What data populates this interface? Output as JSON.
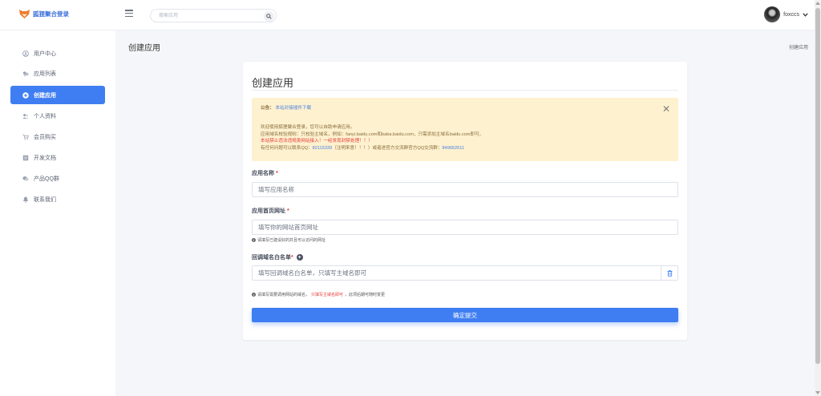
{
  "brand": {
    "name": "狐狸聚合登录",
    "icon": "fox-logo-icon"
  },
  "header": {
    "menu_icon": "hamburger-icon",
    "search_placeholder": "搜索应用",
    "search_icon": "search-icon",
    "username": "foxccs"
  },
  "sidebar": {
    "items": [
      {
        "label": "用户中心",
        "icon": "user-circle-icon",
        "active": false
      },
      {
        "label": "应用列表",
        "icon": "apps-icon",
        "active": false
      },
      {
        "label": "创建应用",
        "icon": "plus-circle-icon",
        "active": true
      },
      {
        "label": "个人资料",
        "icon": "profile-icon",
        "active": false
      },
      {
        "label": "会员购买",
        "icon": "cart-icon",
        "active": false
      },
      {
        "label": "开发文档",
        "icon": "document-icon",
        "active": false
      },
      {
        "label": "产品QQ群",
        "icon": "chat-group-icon",
        "active": false
      },
      {
        "label": "联系我们",
        "icon": "bell-icon",
        "active": false
      }
    ]
  },
  "page": {
    "title": "创建应用",
    "breadcrumb": "创建应用"
  },
  "card": {
    "title": "创建应用",
    "notice": {
      "label": "公告：",
      "link": "本站对接插件下载",
      "close": "✕",
      "line1": "欢迎使用狐狸聚合登录，您可以自助申请应用。",
      "line2": "应用域名校验规则：只校验主域名，例如：fanyi.baidu.com和baba.baidu.com，只需添加主域名baidu.com即可。",
      "line3": "本站禁止违法违规类网站接入！一经发现封禁处理！！！",
      "line4_prefix": "有任何问题可以联系QQ：",
      "qq": "82115339",
      "line4_middle": "（注明来意！！！）或者进官方交流群官方QQ交流群：",
      "group": "849652611"
    },
    "form": {
      "app_name": {
        "label": "应用名称",
        "required": "*",
        "placeholder": "填写应用名称"
      },
      "app_url": {
        "label": "应用首页网址",
        "required": "*",
        "placeholder": "填写你的网站首页网址",
        "help": "请填写已建设好的并且可以访问的网址"
      },
      "callback": {
        "label": "回调域名白名单",
        "required": "*",
        "placeholder": "填写回调域名白名单，只填写主域名即可",
        "help_prefix": "请填写需要调用网站的域名，",
        "help_red": "只填写主域名即可",
        "help_suffix": "，此项后期可随时变更"
      },
      "submit": "确定提交"
    }
  }
}
